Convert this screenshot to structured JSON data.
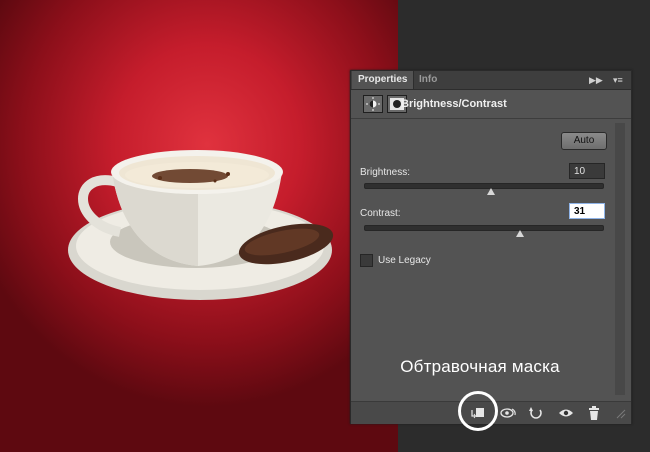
{
  "panel": {
    "tabs": [
      {
        "label": "Properties",
        "active": true
      },
      {
        "label": "Info",
        "active": false
      }
    ],
    "tab_controls": {
      "collapse": "▶▶",
      "menu": "▾≡"
    },
    "title": "Brightness/Contrast",
    "header_icons": [
      "brightness-adjustment-icon",
      "layer-mask-icon"
    ],
    "auto_label": "Auto",
    "brightness": {
      "label": "Brightness:",
      "value": "10",
      "slider_fraction": 0.53
    },
    "contrast": {
      "label": "Contrast:",
      "value": "31",
      "slider_fraction": 0.65
    },
    "use_legacy": {
      "label": "Use Legacy",
      "checked": false
    },
    "footer_icons": [
      "clip-to-layer-icon",
      "view-previous-state-icon",
      "reset-icon",
      "visibility-eye-icon",
      "trash-icon"
    ]
  },
  "annotation": {
    "text": "Обтравочная маска"
  },
  "colors": {
    "accent_focus": "#8fb4e8",
    "panel_bg": "#535353",
    "canvas_red": "#c51d2c"
  }
}
